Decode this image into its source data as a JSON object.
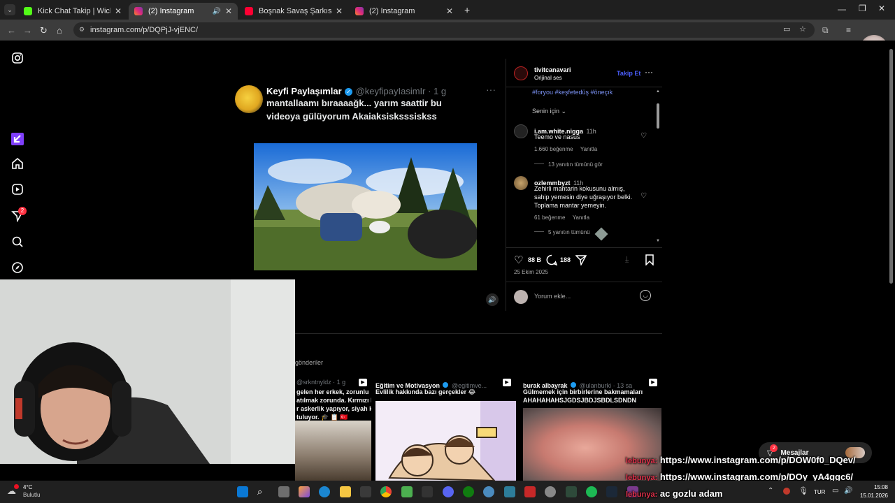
{
  "tabs": [
    {
      "label": "Kick Chat Takip | Wich",
      "color": "#53fc18"
    },
    {
      "label": "(2) Instagram",
      "color": "#e1306c",
      "active": true
    },
    {
      "label": "Boşnak Savaş Şarkısı - Bosn...",
      "color": "#ff0033"
    },
    {
      "label": "(2) Instagram",
      "color": "#e1306c"
    }
  ],
  "address": {
    "url": "instagram.com/p/DQPjJ-vjENC/"
  },
  "sidebar": {
    "notification_badge": "2"
  },
  "tweet": {
    "name": "Keyfi Paylaşımlar",
    "handle": "@keyfipayIasimIr · 1 g",
    "text_line1": "mantallaamı bıraaaağk... yarım saattir bu",
    "text_line2": "videoya gülüyorum Akaiaksisksssiskss"
  },
  "panel": {
    "username": "tivitcanavari",
    "audio": "Orijinal ses",
    "follow_label": "Takip Et",
    "tags": "#foryou #keşfetedüş #öneçık",
    "sort_label": "Senin için",
    "comments": [
      {
        "user": "i.am.white.nigga",
        "time": "11h",
        "text": [
          "Teemo ve nasus"
        ],
        "likes": "1.660 beğenme",
        "reply": "Yanıtla",
        "view_replies": "13 yanıtın tümünü gör"
      },
      {
        "user": "ozlemmbyzt",
        "time": "11h",
        "text": [
          "Zehirli mantarin kokusunu almış,",
          "sahip yemesin diye uğraşıyor belki.",
          "Toplama mantar yemeyin."
        ],
        "likes": "61 beğenme",
        "reply": "Yanıtla",
        "view_replies": "5 yanıtın tümünü"
      }
    ],
    "like_count": "88 B",
    "comment_count": "188",
    "date": "25 Ekim 2025",
    "comment_placeholder": "Yorum ekle..."
  },
  "more_posts": {
    "heading": "gönderiler",
    "cards": [
      {
        "author": "@srkntnyldz · 1 g",
        "lines": [
          "gelen her erkek, zorunlu",
          "atılmak zorunda. Kırmızı k",
          "r askerlik yapıyor, siyah k",
          "tuluyor. 🎓 📋 🇹🇷"
        ]
      },
      {
        "author": "Eğitim ve Motivasyon",
        "handle": "@egitimve...",
        "lines": [
          "Evlilik hakkında bazı gerçekler 😂"
        ]
      },
      {
        "author": "burak albayrak",
        "handle": "@ulanburki · 13 sa",
        "lines": [
          "Gülmemek için birbirlerine bakmamaları",
          "AHAHAHAHSJGDSJBDJSBDLSDNDN"
        ]
      }
    ]
  },
  "messages": {
    "label": "Mesajlar",
    "badge": "2"
  },
  "overlay": {
    "prefix": "lebunya:",
    "line1": "https://www.instagram.com/p/DOW0f0_DQev/",
    "line2": "https://www.instagram.com/p/DOy_yA4ggc6/",
    "line3": "ac gozlu adam"
  },
  "taskbar": {
    "weather_temp": "4°C",
    "weather_desc": "Bulutlu",
    "lang": "TUR",
    "time": "15:08",
    "date": "15.01.2026"
  }
}
